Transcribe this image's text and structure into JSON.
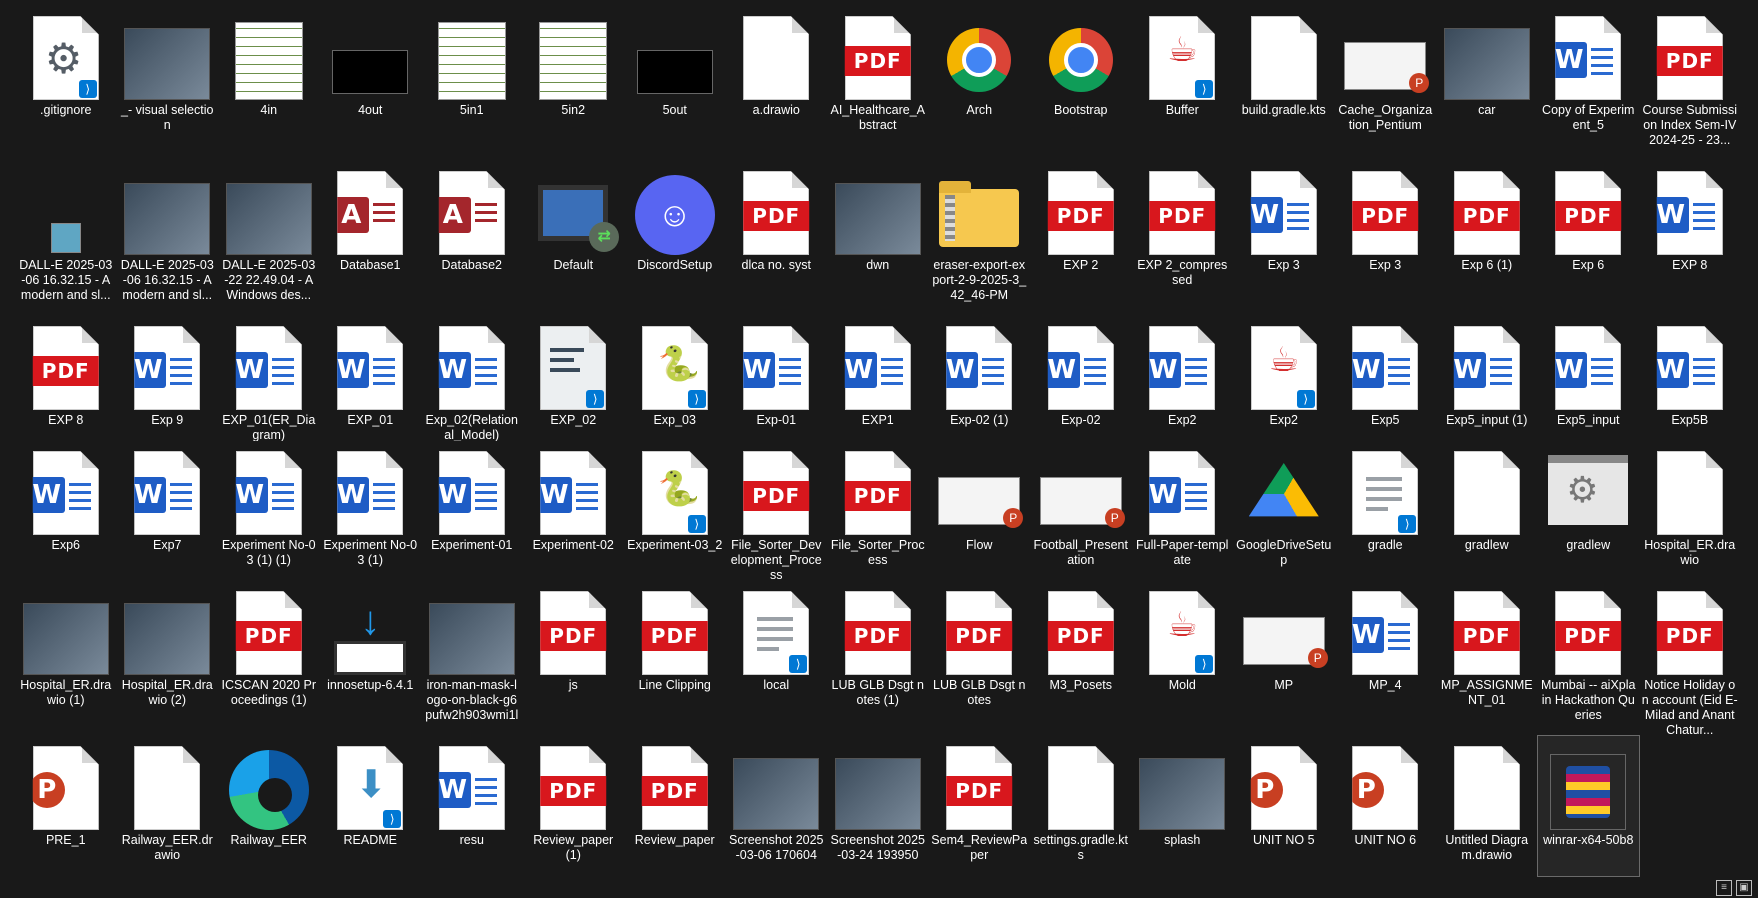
{
  "items": [
    {
      "label": ".gitignore",
      "icon": "vscode-gear-file-icon"
    },
    {
      "label": "_- visual selection",
      "icon": "image-thumbnail-icon"
    },
    {
      "label": "4in",
      "icon": "text-thumbnail-icon"
    },
    {
      "label": "4out",
      "icon": "terminal-thumbnail-icon"
    },
    {
      "label": "5in1",
      "icon": "text-thumbnail-icon"
    },
    {
      "label": "5in2",
      "icon": "text-thumbnail-icon"
    },
    {
      "label": "5out",
      "icon": "terminal-thumbnail-icon"
    },
    {
      "label": "a.drawio",
      "icon": "blank-file-icon"
    },
    {
      "label": "AI_Healthcare_Abstract",
      "icon": "pdf-file-icon"
    },
    {
      "label": "Arch",
      "icon": "chrome-icon"
    },
    {
      "label": "Bootstrap",
      "icon": "chrome-icon"
    },
    {
      "label": "Buffer",
      "icon": "java-file-icon"
    },
    {
      "label": "build.gradle.kts",
      "icon": "blank-file-icon"
    },
    {
      "label": "Cache_Organization_Pentium",
      "icon": "powerpoint-thumbnail-icon"
    },
    {
      "label": "car",
      "icon": "image-thumbnail-icon"
    },
    {
      "label": "Copy of Experiment_5",
      "icon": "word-file-icon"
    },
    {
      "label": "Course Submission Index Sem-IV 2024-25 - 23...",
      "icon": "pdf-file-icon"
    },
    {
      "label": "DALL-E 2025-03-06 16.32.15 - A modern and sl...",
      "icon": "small-image-icon"
    },
    {
      "label": "DALL-E 2025-03-06 16.32.15 - A modern and sl...",
      "icon": "image-thumbnail-icon"
    },
    {
      "label": "DALL-E 2025-03-22 22.49.04 - A Windows des...",
      "icon": "image-thumbnail-icon"
    },
    {
      "label": "Database1",
      "icon": "access-file-icon"
    },
    {
      "label": "Database2",
      "icon": "access-file-icon"
    },
    {
      "label": "Default",
      "icon": "remote-desktop-icon"
    },
    {
      "label": "DiscordSetup",
      "icon": "discord-icon"
    },
    {
      "label": "dlca no. syst",
      "icon": "pdf-file-icon"
    },
    {
      "label": "dwn",
      "icon": "image-thumbnail-icon"
    },
    {
      "label": "eraser-export-export-2-9-2025-3_42_46-PM",
      "icon": "zip-folder-icon"
    },
    {
      "label": "EXP 2",
      "icon": "pdf-file-icon"
    },
    {
      "label": "EXP 2_compressed",
      "icon": "pdf-file-icon"
    },
    {
      "label": "Exp 3",
      "icon": "word-file-icon"
    },
    {
      "label": "Exp 3",
      "icon": "pdf-file-icon"
    },
    {
      "label": "Exp 6 (1)",
      "icon": "pdf-file-icon"
    },
    {
      "label": "Exp 6",
      "icon": "pdf-file-icon"
    },
    {
      "label": "EXP 8",
      "icon": "word-file-icon"
    },
    {
      "label": "EXP 8",
      "icon": "pdf-file-icon"
    },
    {
      "label": "Exp 9",
      "icon": "word-file-icon"
    },
    {
      "label": "EXP_01(ER_Diagram)",
      "icon": "word-file-icon"
    },
    {
      "label": "EXP_01",
      "icon": "word-file-icon"
    },
    {
      "label": "Exp_02(Relational_Model)",
      "icon": "word-file-icon"
    },
    {
      "label": "EXP_02",
      "icon": "vscode-file-icon"
    },
    {
      "label": "Exp_03",
      "icon": "python-file-icon"
    },
    {
      "label": "Exp-01",
      "icon": "word-file-icon"
    },
    {
      "label": "EXP1",
      "icon": "word-file-icon"
    },
    {
      "label": "Exp-02 (1)",
      "icon": "word-file-icon"
    },
    {
      "label": "Exp-02",
      "icon": "word-file-icon"
    },
    {
      "label": "Exp2",
      "icon": "word-file-icon"
    },
    {
      "label": "Exp2",
      "icon": "java-file-icon"
    },
    {
      "label": "Exp5",
      "icon": "word-file-icon"
    },
    {
      "label": "Exp5_input (1)",
      "icon": "word-file-icon"
    },
    {
      "label": "Exp5_input",
      "icon": "word-file-icon"
    },
    {
      "label": "Exp5B",
      "icon": "word-file-icon"
    },
    {
      "label": "Exp6",
      "icon": "word-file-icon"
    },
    {
      "label": "Exp7",
      "icon": "word-file-icon"
    },
    {
      "label": "Experiment No-03 (1) (1)",
      "icon": "word-file-icon"
    },
    {
      "label": "Experiment No-03 (1)",
      "icon": "word-file-icon"
    },
    {
      "label": "Experiment-01",
      "icon": "word-file-icon"
    },
    {
      "label": "Experiment-02",
      "icon": "word-file-icon"
    },
    {
      "label": "Experiment-03_2",
      "icon": "python-file-icon"
    },
    {
      "label": "File_Sorter_Development_Process",
      "icon": "pdf-file-icon"
    },
    {
      "label": "File_Sorter_Process",
      "icon": "pdf-file-icon"
    },
    {
      "label": "Flow",
      "icon": "powerpoint-thumbnail-icon"
    },
    {
      "label": "Football_Presentation",
      "icon": "powerpoint-thumbnail-icon"
    },
    {
      "label": "Full-Paper-template",
      "icon": "word-file-icon"
    },
    {
      "label": "GoogleDriveSetup",
      "icon": "google-drive-icon"
    },
    {
      "label": "gradle",
      "icon": "vscode-text-file-icon"
    },
    {
      "label": "gradlew",
      "icon": "blank-file-icon"
    },
    {
      "label": "gradlew",
      "icon": "settings-file-icon"
    },
    {
      "label": "Hospital_ER.drawio",
      "icon": "blank-file-icon"
    },
    {
      "label": "Hospital_ER.drawio (1)",
      "icon": "image-thumbnail-icon"
    },
    {
      "label": "Hospital_ER.drawio (2)",
      "icon": "image-thumbnail-icon"
    },
    {
      "label": "ICSCAN 2020 Proceedings (1)",
      "icon": "pdf-file-icon"
    },
    {
      "label": "innosetup-6.4.1",
      "icon": "installer-icon"
    },
    {
      "label": "iron-man-mask-logo-on-black-g6pufw2h903wmi1l",
      "icon": "image-thumbnail-icon"
    },
    {
      "label": "js",
      "icon": "pdf-file-icon"
    },
    {
      "label": "Line Clipping",
      "icon": "pdf-file-icon"
    },
    {
      "label": "local",
      "icon": "vscode-text-file-icon"
    },
    {
      "label": "LUB GLB Dsgt notes (1)",
      "icon": "pdf-file-icon"
    },
    {
      "label": "LUB GLB Dsgt notes",
      "icon": "pdf-file-icon"
    },
    {
      "label": "M3_Posets",
      "icon": "pdf-file-icon"
    },
    {
      "label": "Mold",
      "icon": "java-file-icon"
    },
    {
      "label": "MP",
      "icon": "powerpoint-thumbnail-icon"
    },
    {
      "label": "MP_4",
      "icon": "word-file-icon"
    },
    {
      "label": "MP_ASSIGNMENT_01",
      "icon": "pdf-file-icon"
    },
    {
      "label": "Mumbai -- aiXplain Hackathon Queries",
      "icon": "pdf-file-icon"
    },
    {
      "label": "Notice Holiday on account (Eid E- Milad and Anant Chatur...",
      "icon": "pdf-file-icon"
    },
    {
      "label": "PRE_1",
      "icon": "powerpoint-file-icon"
    },
    {
      "label": "Railway_EER.drawio",
      "icon": "blank-file-icon"
    },
    {
      "label": "Railway_EER",
      "icon": "edge-icon"
    },
    {
      "label": "README",
      "icon": "vscode-download-file-icon"
    },
    {
      "label": "resu",
      "icon": "word-file-icon"
    },
    {
      "label": "Review_paper (1)",
      "icon": "pdf-file-icon"
    },
    {
      "label": "Review_paper",
      "icon": "pdf-file-icon"
    },
    {
      "label": "Screenshot 2025-03-06 170604",
      "icon": "image-thumbnail-icon"
    },
    {
      "label": "Screenshot 2025-03-24 193950",
      "icon": "image-thumbnail-icon"
    },
    {
      "label": "Sem4_ReviewPaper",
      "icon": "pdf-file-icon"
    },
    {
      "label": "settings.gradle.kts",
      "icon": "blank-file-icon"
    },
    {
      "label": "splash",
      "icon": "image-thumbnail-icon"
    },
    {
      "label": "UNIT NO 5",
      "icon": "powerpoint-file-icon"
    },
    {
      "label": "UNIT NO 6",
      "icon": "powerpoint-file-icon"
    },
    {
      "label": "Untitled Diagram.drawio",
      "icon": "blank-file-icon"
    },
    {
      "label": "winrar-x64-50b8",
      "icon": "winrar-icon"
    }
  ],
  "pdf_text": "PDF",
  "colors": {
    "background": "#191919",
    "pdf_red": "#d8171d",
    "word_blue": "#1e5cc5",
    "ppt_orange": "#c83f22"
  }
}
